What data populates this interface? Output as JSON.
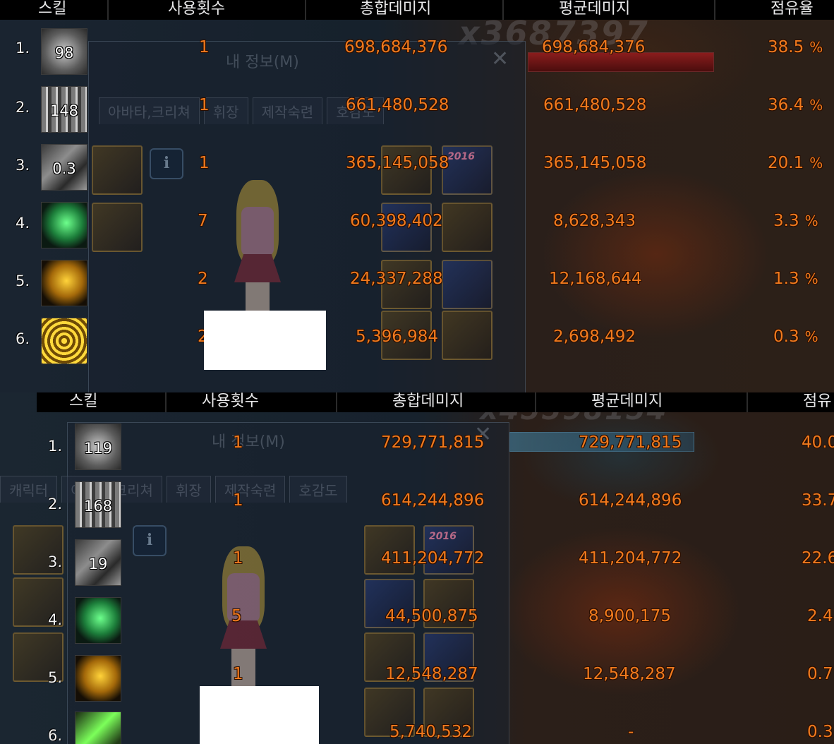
{
  "headers": {
    "skill": "스킬",
    "uses": "사용횟수",
    "total_damage": "총합데미지",
    "avg_damage": "평균데미지",
    "share": "점유율"
  },
  "panel1": {
    "header_share_label": "점유율",
    "bg_counter": "x3687397",
    "info_window": {
      "title": "내 정보(M)",
      "close": "✕",
      "tabs": [
        "아바타,크리쳐",
        "휘장",
        "제작숙련",
        "호감도"
      ],
      "info_button": "i"
    },
    "rows": [
      {
        "rank": "1.",
        "icon": "cross-blade-skill-icon",
        "icon_label": "98",
        "uses": "1",
        "total": "698,684,376",
        "avg": "698,684,376",
        "share": "38.5",
        "share_unit": "%"
      },
      {
        "rank": "2.",
        "icon": "chain-skill-icon",
        "icon_label": "148",
        "uses": "1",
        "total": "661,480,528",
        "avg": "661,480,528",
        "share": "36.4",
        "share_unit": "%"
      },
      {
        "rank": "3.",
        "icon": "mech-skill-icon",
        "icon_label": "0.3",
        "uses": "1",
        "total": "365,145,058",
        "avg": "365,145,058",
        "share": "20.1",
        "share_unit": "%"
      },
      {
        "rank": "4.",
        "icon": "green-slash-skill-icon",
        "icon_label": "",
        "uses": "7",
        "total": "60,398,402",
        "avg": "8,628,343",
        "share": "3.3",
        "share_unit": "%"
      },
      {
        "rank": "5.",
        "icon": "gold-slash-skill-icon",
        "icon_label": "",
        "uses": "2",
        "total": "24,337,288",
        "avg": "12,168,644",
        "share": "1.3",
        "share_unit": "%"
      },
      {
        "rank": "6.",
        "icon": "gold-ring-skill-icon",
        "icon_label": "",
        "uses": "2",
        "total": "5,396,984",
        "avg": "2,698,492",
        "share": "0.3",
        "share_unit": "%"
      }
    ]
  },
  "panel2": {
    "header_share_label": "점유",
    "bg_counter": "x45598154",
    "info_window": {
      "title": "내 정보(M)",
      "close": "✕",
      "tabs": [
        "캐릭터",
        "아바타,크리쳐",
        "휘장",
        "제작숙련",
        "호감도"
      ],
      "info_button": "i"
    },
    "rows": [
      {
        "rank": "1.",
        "icon": "cross-blade-skill-icon",
        "icon_label": "119",
        "uses": "1",
        "total": "729,771,815",
        "avg": "729,771,815",
        "share": "40.0"
      },
      {
        "rank": "2.",
        "icon": "chain-skill-icon",
        "icon_label": "168",
        "uses": "1",
        "total": "614,244,896",
        "avg": "614,244,896",
        "share": "33.7"
      },
      {
        "rank": "3.",
        "icon": "mech-skill-icon",
        "icon_label": "19",
        "uses": "1",
        "total": "411,204,772",
        "avg": "411,204,772",
        "share": "22.6"
      },
      {
        "rank": "4.",
        "icon": "green-slash-skill-icon",
        "icon_label": "",
        "uses": "5",
        "total": "44,500,875",
        "avg": "8,900,175",
        "share": "2.4"
      },
      {
        "rank": "5.",
        "icon": "gold-slash-skill-icon",
        "icon_label": "",
        "uses": "1",
        "total": "12,548,287",
        "avg": "12,548,287",
        "share": "0.7"
      },
      {
        "rank": "6.",
        "icon": "lime-blade-skill-icon",
        "icon_label": "",
        "uses": "",
        "total": "5,740,532",
        "avg": "-",
        "share": "0.3"
      }
    ]
  },
  "colors": {
    "value_orange": "#f07a1e",
    "header_bg": "#000000",
    "header_text": "#e9e9ea"
  }
}
